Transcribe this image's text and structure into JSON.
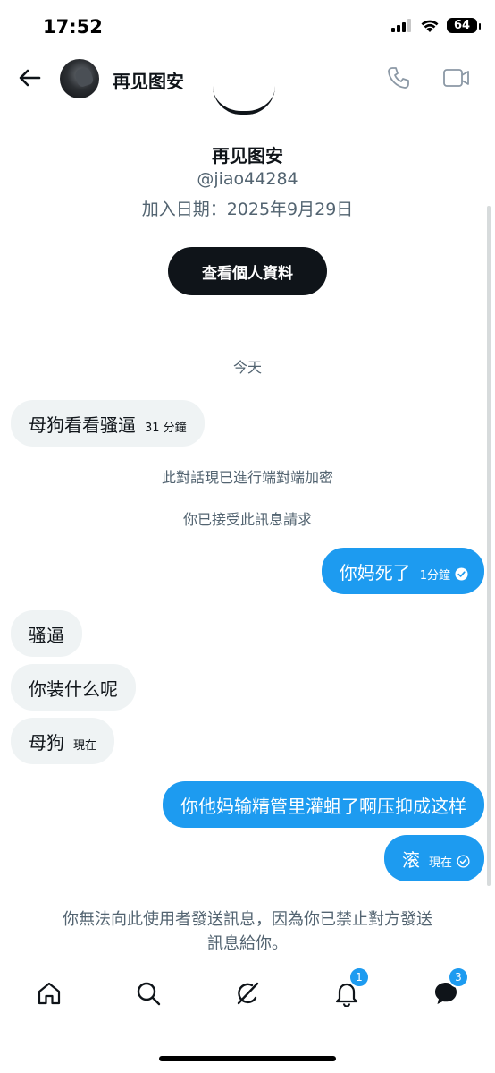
{
  "status": {
    "time": "17:52",
    "battery": "64"
  },
  "header": {
    "name": "再见图安"
  },
  "profile": {
    "name": "再见图安",
    "handle": "@jiao44284",
    "joined": "加入日期：2025年9月29日",
    "view_profile_label": "查看個人資料"
  },
  "day_label": "今天",
  "system_messages": [
    "此對話現已進行端對端加密",
    "你已接受此訊息請求"
  ],
  "messages": [
    {
      "text": "母狗看看骚逼",
      "time": "31 分鐘",
      "direction": "in"
    },
    {
      "text": "你妈死了",
      "time": "1分鐘",
      "direction": "out"
    },
    {
      "text": "骚逼",
      "time": "",
      "direction": "in"
    },
    {
      "text": "你装什么呢",
      "time": "",
      "direction": "in"
    },
    {
      "text": "母狗",
      "time": "現在",
      "direction": "in"
    },
    {
      "text": "你他妈输精管里灌蛆了啊压抑成这样",
      "time": "",
      "direction": "out"
    },
    {
      "text": "滚",
      "time": "現在",
      "direction": "out"
    }
  ],
  "blocked_notice": {
    "line1": "你無法向此使用者發送訊息，因為你已禁止對方發送",
    "line2": "訊息給你。"
  },
  "tabbar": {
    "notifications_badge": "1",
    "messages_badge": "3"
  },
  "colors": {
    "accent": "#1d9bf0",
    "incoming_bg": "#eff3f4",
    "text": "#0f1419",
    "muted": "#536471"
  },
  "icons": [
    "back-arrow-icon",
    "phone-icon",
    "video-icon",
    "home-icon",
    "search-icon",
    "grok-icon",
    "bell-icon",
    "messages-icon",
    "read-check-icon"
  ]
}
